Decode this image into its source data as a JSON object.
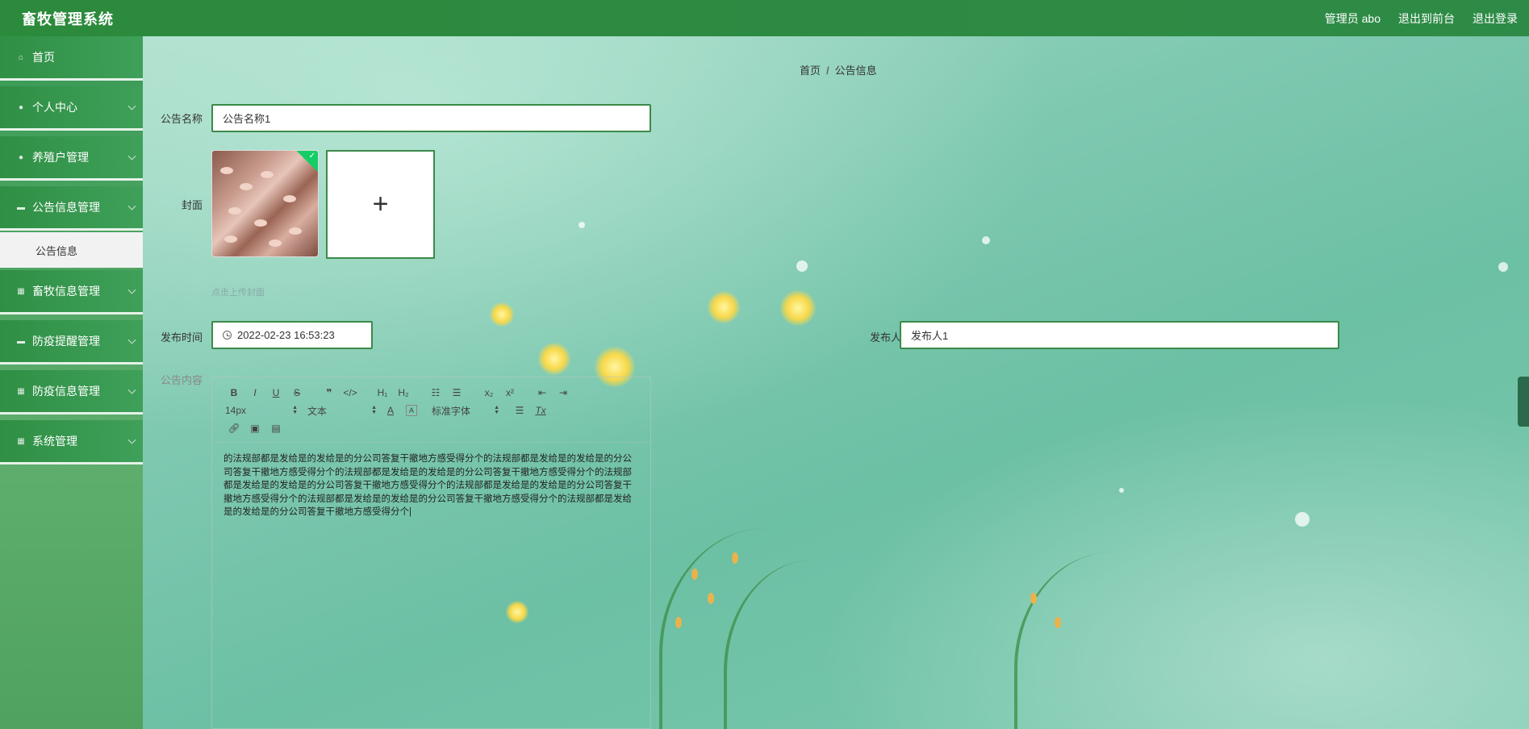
{
  "header": {
    "title": "畜牧管理系统",
    "admin_label": "管理员 abo",
    "to_frontend": "退出到前台",
    "logout": "退出登录"
  },
  "sidebar": {
    "items": [
      {
        "label": "首页",
        "icon": "home-icon"
      },
      {
        "label": "个人中心",
        "icon": "user-icon"
      },
      {
        "label": "养殖户管理",
        "icon": "user-icon"
      },
      {
        "label": "公告信息管理",
        "icon": "notice-icon"
      },
      {
        "label": "畜牧信息管理",
        "icon": "grid-icon"
      },
      {
        "label": "防疫提醒管理",
        "icon": "notice-icon"
      },
      {
        "label": "防疫信息管理",
        "icon": "grid-icon"
      },
      {
        "label": "系统管理",
        "icon": "grid-icon"
      }
    ],
    "submenu_label": "公告信息"
  },
  "breadcrumb": {
    "home": "首页",
    "separator": "/",
    "current": "公告信息"
  },
  "form": {
    "name_label": "公告名称",
    "name_value": "公告名称1",
    "cover_label": "封面",
    "upload_plus": "+",
    "upload_hint": "点击上传封面",
    "time_label": "发布时间",
    "time_value": "2022-02-23 16:53:23",
    "publisher_label": "发布人",
    "publisher_value": "发布人1",
    "content_label": "公告内容"
  },
  "editor": {
    "font_size": "14px",
    "paragraph": "文本",
    "font_family": "标准字体",
    "content": "的法规部都是发给是的发给是的分公司答复干撤地方感受得分个的法规部都是发给是的发给是的分公司答复干撤地方感受得分个的法规部都是发给是的发给是的分公司答复干撤地方感受得分个的法规部都是发给是的发给是的分公司答复干撤地方感受得分个的法规部都是发给是的发给是的分公司答复干撤地方感受得分个的法规部都是发给是的发给是的分公司答复干撤地方感受得分个的法规部都是发给是的发给是的分公司答复干撤地方感受得分个|"
  },
  "colors": {
    "header_bg": "#2c8a3c",
    "sidebar_item": "#2f8f44",
    "input_border": "#3b8a4a",
    "upload_check": "#13ce66"
  }
}
